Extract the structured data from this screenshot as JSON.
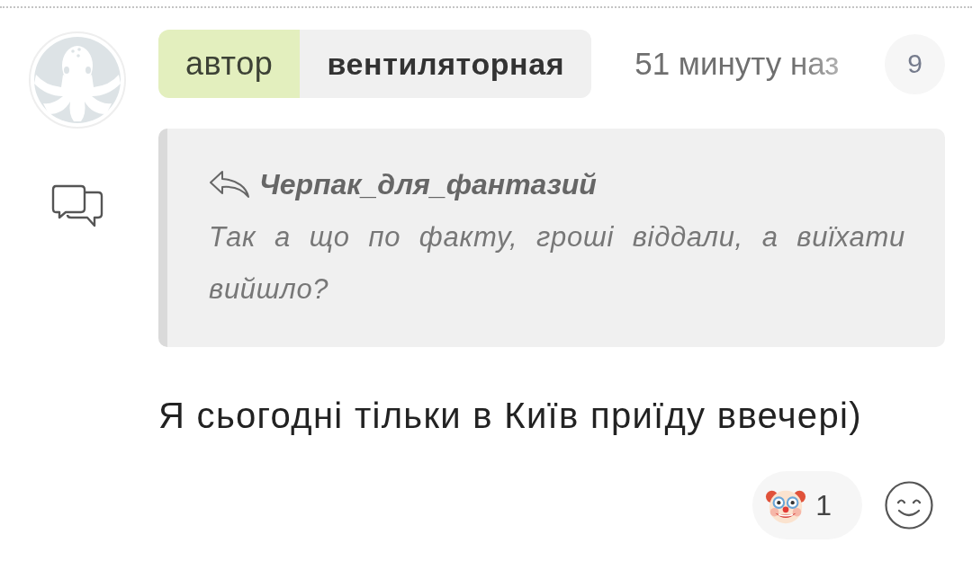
{
  "comment": {
    "author_badge": "автор",
    "username": "вентиляторная",
    "timestamp": "51 минуту наз",
    "reply_count": "9",
    "quote": {
      "author": "Черпак_для_фантазий",
      "text": "Так а що по факту, гроші віддали, а виїхати вийшло?"
    },
    "text": "Я сьогодні тільки в Київ приїду ввечері)",
    "reactions": [
      {
        "count": "1"
      }
    ]
  }
}
